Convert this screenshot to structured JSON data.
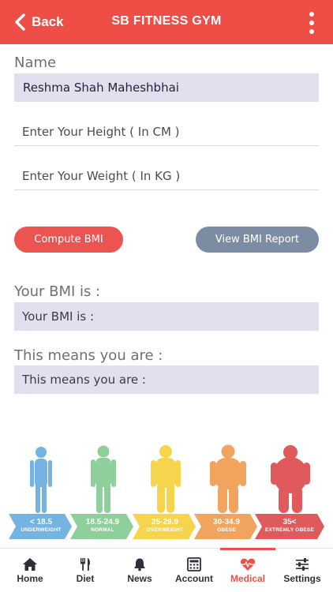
{
  "header": {
    "back_label": "Back",
    "title": "SB FITNESS GYM",
    "accent": "#ef4e46"
  },
  "form": {
    "name_label": "Name",
    "name_value": "Reshma Shah Maheshbhai",
    "height_placeholder": "Enter Your Height ( In CM )",
    "weight_placeholder": "Enter Your Weight ( In KG )"
  },
  "buttons": {
    "compute": "Compute BMI",
    "report": "View BMI Report"
  },
  "results": {
    "bmi_label": "Your BMI is :",
    "bmi_value": "Your BMI is :",
    "means_label": "This means you are :",
    "means_value": "This means you are :"
  },
  "bmi_scale": [
    {
      "range": "< 18.5",
      "category": "UNDERWEIGHT",
      "color": "#74b3e2"
    },
    {
      "range": "18.5-24.9",
      "category": "NORMAL",
      "color": "#8fcf9b"
    },
    {
      "range": "25-29.9",
      "category": "OVERWEIGHT",
      "color": "#f6d54c"
    },
    {
      "range": "30-34.9",
      "category": "OBESE",
      "color": "#f0a45e"
    },
    {
      "range": "35<",
      "category": "EXTREMLY OBESE",
      "color": "#e0595b"
    }
  ],
  "tabs": [
    {
      "label": "Home",
      "icon": "home-icon"
    },
    {
      "label": "Diet",
      "icon": "cutlery-icon"
    },
    {
      "label": "News",
      "icon": "bell-icon"
    },
    {
      "label": "Account",
      "icon": "calculator-icon"
    },
    {
      "label": "Medical",
      "icon": "heartbeat-icon",
      "active": true
    },
    {
      "label": "Settings",
      "icon": "sliders-icon"
    }
  ]
}
